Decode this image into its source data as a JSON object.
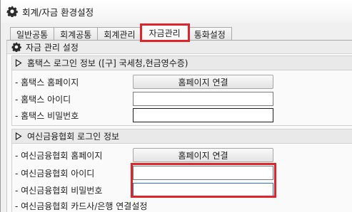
{
  "window": {
    "title": "회계/자금 환경설정",
    "icon": "gear-icon"
  },
  "tabs": [
    {
      "label": "일반공통",
      "active": false
    },
    {
      "label": "회계공통",
      "active": false
    },
    {
      "label": "회계관리",
      "active": false
    },
    {
      "label": "자금관리",
      "active": true
    },
    {
      "label": "통화설정",
      "active": false
    }
  ],
  "page": {
    "header": "자금 관리 설정",
    "hometax": {
      "title": "홈택스 로그인 정보 ([구] 국세청,현금영수증)",
      "homepage_label": "- 홈택스 홈페이지",
      "homepage_button": "홈페이지 연결",
      "id_label": "- 홈택스 아이디",
      "id_value": "",
      "pw_label": "- 홈택스 비밀번호",
      "pw_value": ""
    },
    "crefia": {
      "title": "여신금융협회 로그인 정보",
      "homepage_label": "- 여신금융협회 홈페이지",
      "homepage_button": "홈페이지 연결",
      "id_label": "- 여신금융협회 아이디",
      "id_value": "",
      "pw_label": "- 여신금융협회 비밀번호",
      "pw_value": "",
      "card_label": "- 여신금융협회 카드사/은행 연결설정"
    }
  },
  "colors": {
    "highlight": "#e0252a",
    "focus_border": "#2f6fbf"
  }
}
